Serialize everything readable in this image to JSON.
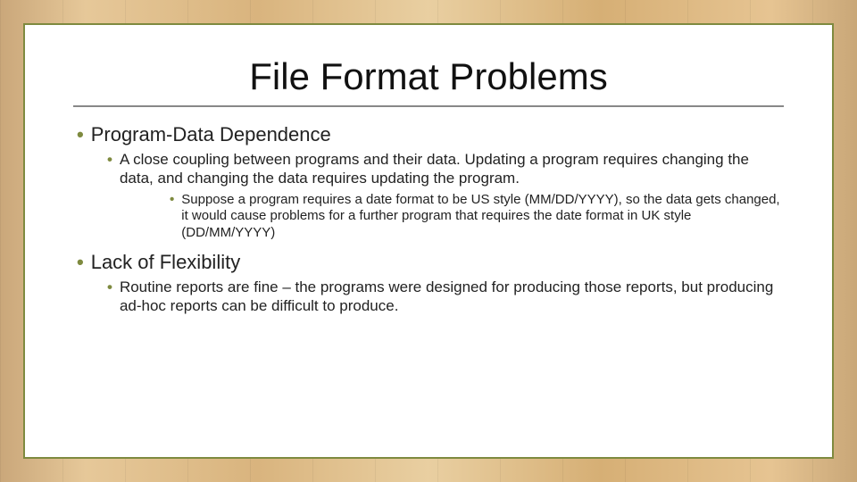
{
  "slide": {
    "title": "File Format Problems",
    "items": [
      {
        "text": "Program-Data Dependence",
        "children": [
          {
            "text": "A close coupling between programs and their data.  Updating a program requires changing the data, and changing the data requires updating the program.",
            "children": [
              {
                "text": "Suppose a program requires a date format to be US style (MM/DD/YYYY), so the data gets changed, it would cause problems for a further program that requires the date format in UK style (DD/MM/YYYY)"
              }
            ]
          }
        ]
      },
      {
        "text": "Lack of Flexibility",
        "children": [
          {
            "text": "Routine reports are fine – the programs were designed for producing those reports, but producing ad-hoc reports can be difficult to produce."
          }
        ]
      }
    ]
  }
}
